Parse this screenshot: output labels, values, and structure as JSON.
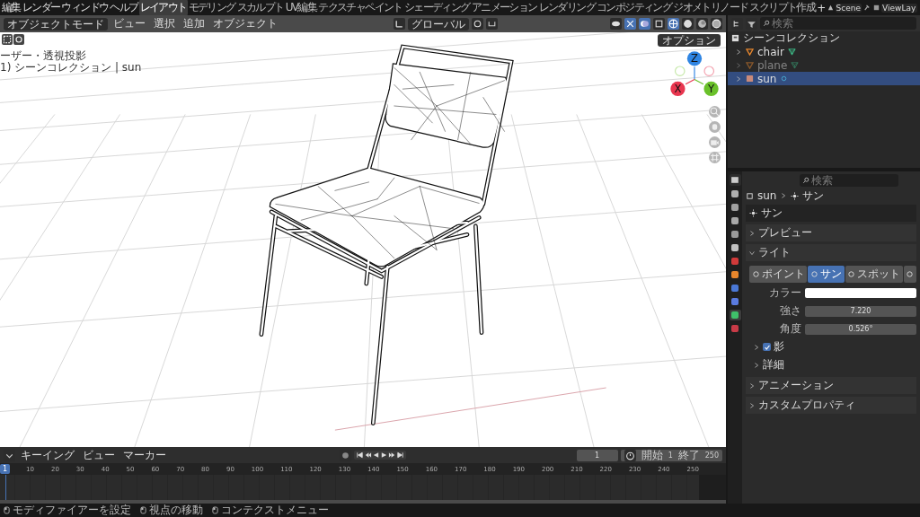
{
  "topbar": {
    "menus": [
      "編集",
      "レンダー",
      "ウィンドウ",
      "ヘルプ"
    ],
    "workspaces": [
      {
        "label": "レイアウト",
        "selected": true
      },
      {
        "label": "モデリング",
        "selected": false
      },
      {
        "label": "スカルプト",
        "selected": false
      },
      {
        "label": "UV編集",
        "selected": false
      },
      {
        "label": "テクスチャペイント",
        "selected": false
      },
      {
        "label": "シェーディング",
        "selected": false
      },
      {
        "label": "アニメーション",
        "selected": false
      },
      {
        "label": "レンダリング",
        "selected": false
      },
      {
        "label": "コンポジティング",
        "selected": false
      },
      {
        "label": "ジオメトリノード",
        "selected": false
      },
      {
        "label": "スクリプト作成",
        "selected": false
      }
    ],
    "add_tab": "+",
    "scene": "Scene",
    "view_layer": "ViewLay"
  },
  "viewport": {
    "mode": "オブジェクトモード",
    "menus": [
      "ビュー",
      "選択",
      "追加",
      "オブジェクト"
    ],
    "orientation": "グローバル",
    "options": "オプション",
    "overlay_text": [
      "ーザー・透視投影",
      "1) シーンコレクション | sun"
    ],
    "gizmo": [
      {
        "label": "Z",
        "color": "#2f85e3"
      },
      {
        "label": "X",
        "color": "#e8364f"
      },
      {
        "label": "Y",
        "color": "#6ac12a"
      }
    ]
  },
  "outliner": {
    "search_placeholder": "検索",
    "collection": "シーンコレクション",
    "items": [
      {
        "kind": "mesh",
        "name": "chair",
        "selected": false,
        "hidden": false
      },
      {
        "kind": "mesh",
        "name": "plane",
        "selected": false,
        "hidden": true
      },
      {
        "kind": "light",
        "name": "sun",
        "selected": true,
        "hidden": false
      }
    ]
  },
  "properties": {
    "search_placeholder": "検索",
    "tabs": [
      {
        "color": "#b0b0b0",
        "selected": false
      },
      {
        "color": "#a0a0a0",
        "selected": false
      },
      {
        "color": "#a8a8a8",
        "selected": false
      },
      {
        "color": "#9a9a9a",
        "selected": false
      },
      {
        "color": "#c0c0c0",
        "selected": false
      },
      {
        "color": "#d13a3a",
        "selected": false
      },
      {
        "color": "#e8862c",
        "selected": false
      },
      {
        "color": "#4a78d6",
        "selected": false
      },
      {
        "color": "#5a7be0",
        "selected": false
      },
      {
        "color": "#3fbf6a",
        "selected": true
      },
      {
        "color": "#c83b47",
        "selected": false
      }
    ],
    "breadcrumb": [
      "sun",
      "サン"
    ],
    "datablock": "サン",
    "panels": [
      {
        "kind": "plain",
        "label": "プレビュー",
        "expanded": false
      },
      {
        "kind": "light",
        "label": "ライト",
        "expanded": true
      },
      {
        "kind": "plain",
        "label": "アニメーション",
        "expanded": false
      },
      {
        "kind": "plain",
        "label": "カスタムプロパティ",
        "expanded": false
      }
    ],
    "light_types": [
      {
        "label": "ポイント",
        "selected": false
      },
      {
        "label": "サン",
        "selected": true
      },
      {
        "label": "スポット",
        "selected": false
      },
      {
        "selected": false
      }
    ],
    "fields": [
      {
        "kind": "color",
        "label": "カラー",
        "color": "#ffffff"
      },
      {
        "kind": "number",
        "label": "強さ",
        "value": "7.220"
      },
      {
        "kind": "number",
        "label": "角度",
        "value": "0.526°"
      }
    ],
    "subpanels": [
      {
        "kind": "checkbox",
        "label": "影",
        "checked": true,
        "expanded": false
      },
      {
        "kind": "plain",
        "label": "詳細",
        "expanded": false
      }
    ]
  },
  "timeline": {
    "menus": [
      "キーイング",
      "ビュー",
      "マーカー"
    ],
    "current_frame": "1",
    "start_label": "開始",
    "start": "1",
    "end_label": "終了",
    "end": "250",
    "playhead": "1",
    "ticks": [
      "10",
      "20",
      "30",
      "40",
      "50",
      "60",
      "70",
      "80",
      "90",
      "100",
      "110",
      "120",
      "130",
      "140",
      "150",
      "160",
      "170",
      "180",
      "190",
      "200",
      "210",
      "220",
      "230",
      "240",
      "250"
    ]
  },
  "status_bar": [
    "モディファイアーを設定",
    "視点の移動",
    "コンテクストメニュー"
  ]
}
